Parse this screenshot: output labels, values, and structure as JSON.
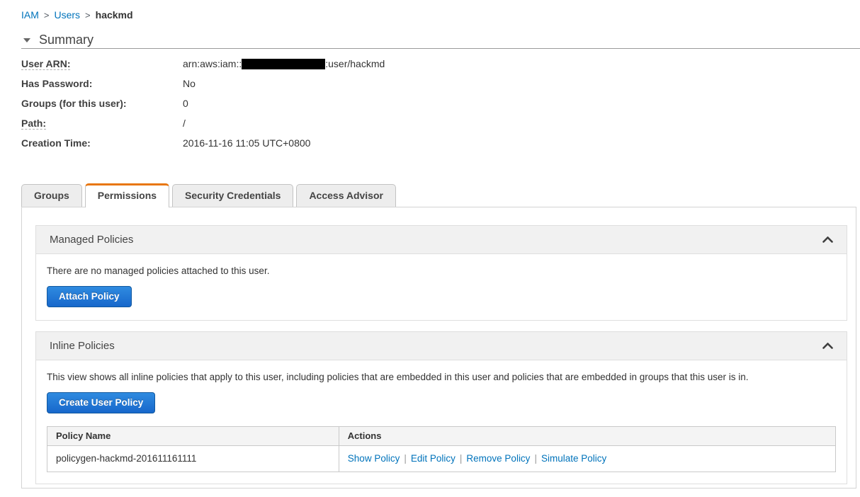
{
  "breadcrumb": {
    "separator": ">",
    "items": [
      {
        "label": "IAM"
      },
      {
        "label": "Users"
      }
    ],
    "current": "hackmd"
  },
  "summary": {
    "title": "Summary",
    "fields": [
      {
        "label": "User ARN:",
        "value_prefix": "arn:aws:iam::",
        "value_suffix": ":user/hackmd",
        "redacted": true
      },
      {
        "label": "Has Password:",
        "value": "No"
      },
      {
        "label": "Groups (for this user):",
        "value": "0"
      },
      {
        "label": "Path:",
        "value": "/"
      },
      {
        "label": "Creation Time:",
        "value": "2016-11-16 11:05 UTC+0800"
      }
    ]
  },
  "tabs": [
    {
      "label": "Groups",
      "active": false
    },
    {
      "label": "Permissions",
      "active": true
    },
    {
      "label": "Security Credentials",
      "active": false
    },
    {
      "label": "Access Advisor",
      "active": false
    }
  ],
  "managed_policies": {
    "title": "Managed Policies",
    "empty_message": "There are no managed policies attached to this user.",
    "attach_button_label": "Attach Policy"
  },
  "inline_policies": {
    "title": "Inline Policies",
    "description": "This view shows all inline policies that apply to this user, including policies that are embedded in this user and policies that are embedded in groups that this user is in.",
    "create_button_label": "Create User Policy",
    "table": {
      "headers": [
        "Policy Name",
        "Actions"
      ],
      "action_separator": "|",
      "rows": [
        {
          "policy_name": "policygen-hackmd-201611161111",
          "actions": [
            "Show Policy",
            "Edit Policy",
            "Remove Policy",
            "Simulate Policy"
          ]
        }
      ]
    }
  },
  "colors": {
    "link_blue": "#0073bb",
    "tab_accent_orange": "#e8760d",
    "button_blue_top": "#2f8be0",
    "button_blue_bottom": "#1767cb",
    "section_header_bg": "#f1f1f1"
  }
}
